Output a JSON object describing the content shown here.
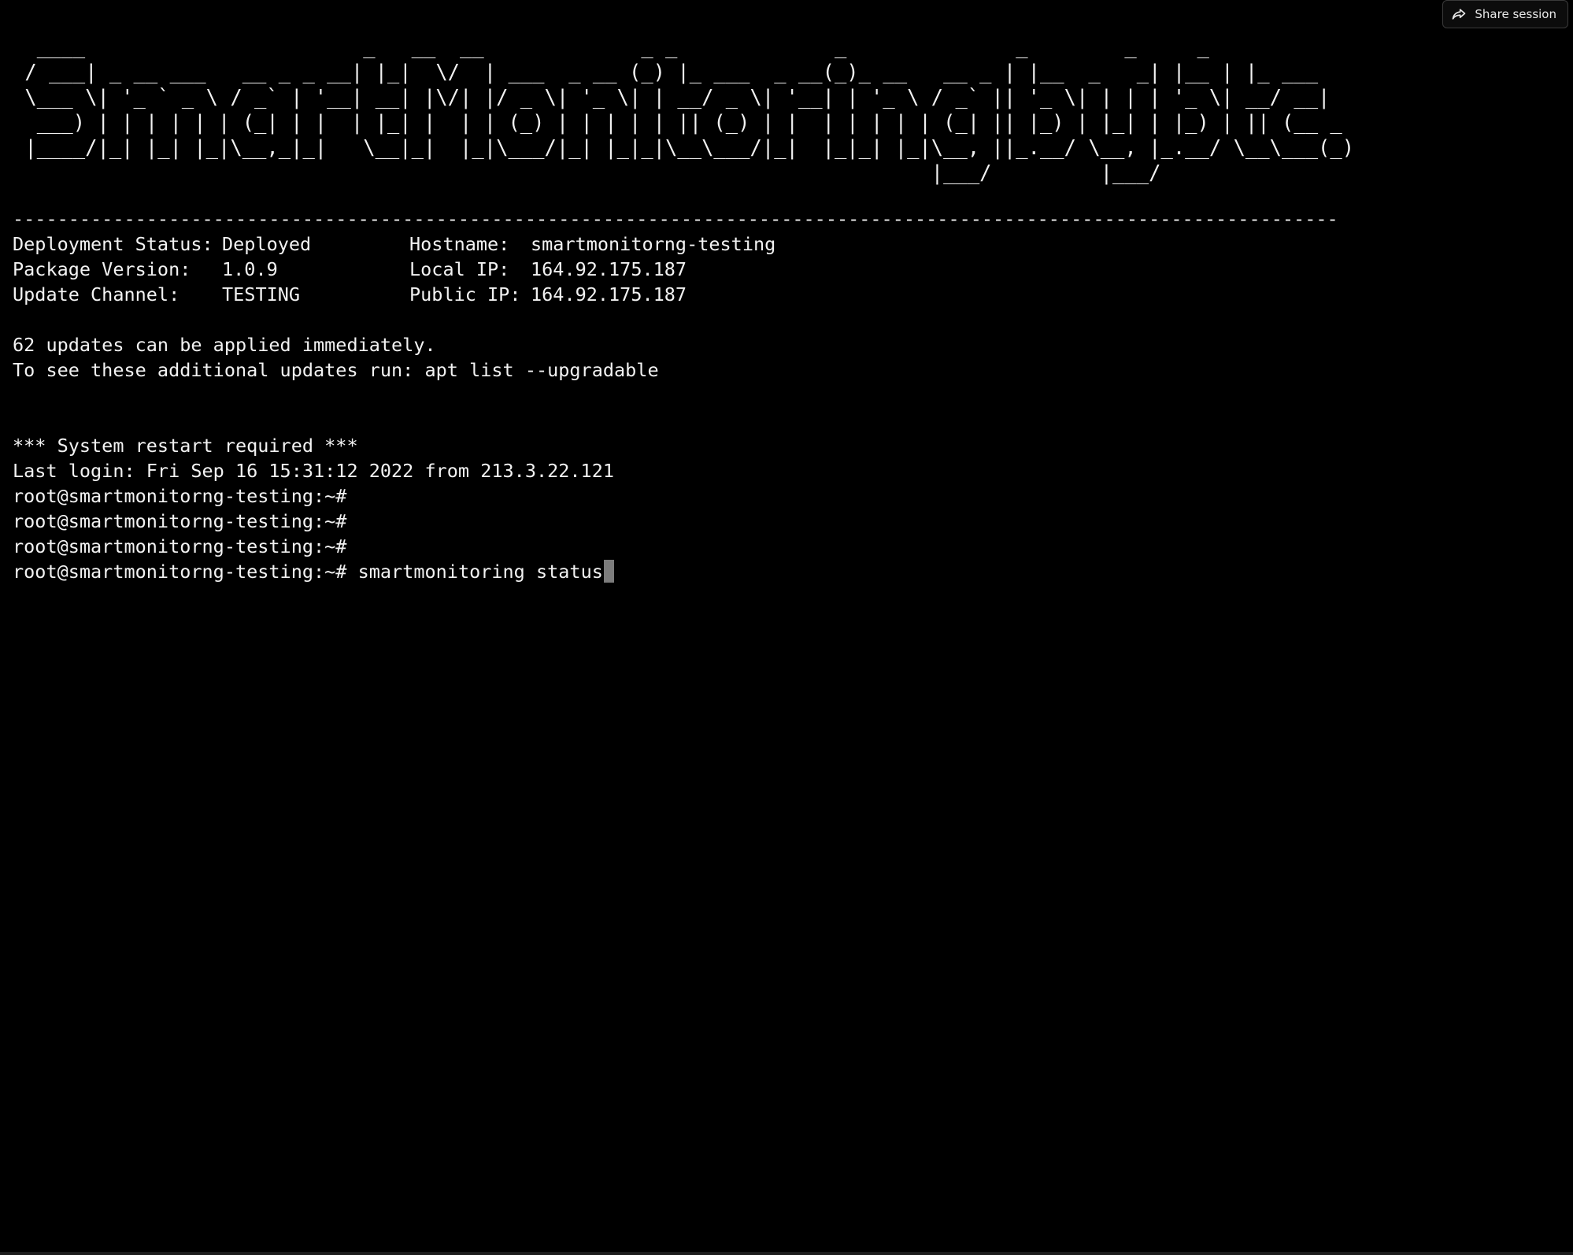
{
  "share": {
    "label": "Share session",
    "icon": "share-icon"
  },
  "banner": {
    "lines": [
      "  ____                       _   __  __             _ _             _              _        _     _     ",
      " / ___| _ __ ___   __ _ _ __| |_|  \\/  | ___  _ __ (_) |_ ___  _ __(_)_ __   __ _ | |__  _   _| |__ | |_ ___ ",
      " \\___ \\| '_ ` _ \\ / _` | '__| __| |\\/| |/ _ \\| '_ \\| | __/ _ \\| '__| | '_ \\ / _` || '_ \\| | | | '_ \\| __/ __|",
      "  ___) | | | | | | (_| | |  | |_| |  | | (_) | | | | | || (_) | |  | | | | | (_| || |_) | |_| | |_) | || (__ _",
      " |____/|_| |_| |_|\\__,_|_|   \\__|_|  |_|\\___/|_| |_|_|\\__\\___/|_|  |_|_| |_|\\__, ||_.__/ \\__, |_.__/ \\__\\___(_)",
      "                                                                            |___/         |___/               "
    ]
  },
  "divider": "-------------------------------------------------------------------------------------------------------------------------",
  "info": {
    "rows": [
      {
        "left_label": "Deployment Status:",
        "left_value": "Deployed",
        "right_label": "Hostname:",
        "right_value": "smartmonitorng-testing"
      },
      {
        "left_label": "Package Version:",
        "left_value": "1.0.9",
        "right_label": "Local IP:",
        "right_value": "164.92.175.187"
      },
      {
        "left_label": "Update Channel:",
        "left_value": "TESTING",
        "right_label": "Public IP:",
        "right_value": "164.92.175.187"
      }
    ]
  },
  "messages": {
    "updates": "62 updates can be applied immediately.",
    "updates_hint": "To see these additional updates run: apt list --upgradable",
    "restart": "*** System restart required ***",
    "last_login": "Last login: Fri Sep 16 15:31:12 2022 from 213.3.22.121"
  },
  "prompt": "root@smartmonitorng-testing:~#",
  "current_command": "smartmonitoring status"
}
